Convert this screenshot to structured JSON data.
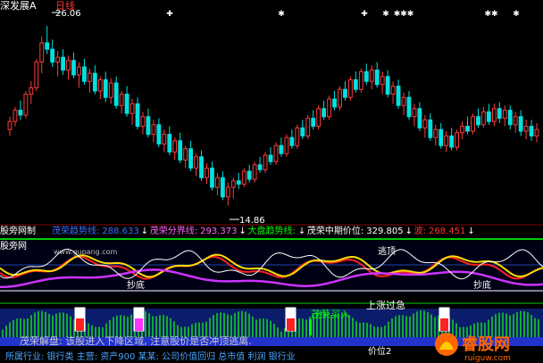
{
  "window": {
    "title": "深发展A",
    "period_label": "日线"
  },
  "price_panel": {
    "high_label": "26.06",
    "low_label": "14.86",
    "event_marks": [
      "✚",
      "✱",
      "✚",
      "✱",
      "✱✱✱",
      "✱✱",
      "✱"
    ]
  },
  "legend": {
    "prefix": "股旁网制",
    "items": [
      {
        "label": "茂荣趋势线:",
        "value": "288.633",
        "color": "#3a6bff"
      },
      {
        "label": "茂荣分界线:",
        "value": "293.373",
        "color": "#ff66ff"
      },
      {
        "label": "大盘趋势线:",
        "value": "",
        "color": "#00ff00"
      },
      {
        "label": "茂荣中期价位:",
        "value": "329.805",
        "color": "#ffffff"
      },
      {
        "label": "波:",
        "value": "268.451",
        "color": "#ff3333"
      }
    ]
  },
  "indicator_panel": {
    "site_label": "股旁网",
    "watermark": "www.gupang.com",
    "annotations": [
      "逃顶",
      "抄底",
      "抄底"
    ]
  },
  "signal_panel": {
    "annotations": [
      "上涨过急",
      "茂荣买入",
      "价位2"
    ]
  },
  "footer": {
    "line1": "茂荣解盘: 该股进入下降区域, 注意股价是否冲顶逃离.",
    "line2": "所属行业: 银行类   主营: 资产900   某某: 公司价值回归 总市值 利润 银行业"
  },
  "logo": {
    "text": "睿股网",
    "url": "ruiguw.com"
  },
  "chart_data": {
    "type": "candlestick",
    "title": "深发展A 日线",
    "xlabel": "",
    "ylabel": "",
    "ylim": [
      14,
      27
    ],
    "grid": false,
    "legend_position": "top-left",
    "annotations": [
      {
        "label": "26.06",
        "type": "high"
      },
      {
        "label": "14.86",
        "type": "low"
      }
    ],
    "candles": [
      [
        19.6,
        20.4,
        19.2,
        20.1
      ],
      [
        20.1,
        21.0,
        19.8,
        20.8
      ],
      [
        20.8,
        21.4,
        20.2,
        20.5
      ],
      [
        20.5,
        22.0,
        20.3,
        21.8
      ],
      [
        21.8,
        22.6,
        21.2,
        22.2
      ],
      [
        22.2,
        24.0,
        22.0,
        23.8
      ],
      [
        23.8,
        25.4,
        23.1,
        25.0
      ],
      [
        25.0,
        26.06,
        24.3,
        24.6
      ],
      [
        24.6,
        25.2,
        23.5,
        23.8
      ],
      [
        23.8,
        24.5,
        22.9,
        24.1
      ],
      [
        24.1,
        24.6,
        23.0,
        23.3
      ],
      [
        23.3,
        24.2,
        22.7,
        23.9
      ],
      [
        23.9,
        24.4,
        22.8,
        23.0
      ],
      [
        23.0,
        23.8,
        22.2,
        23.5
      ],
      [
        23.5,
        24.0,
        22.4,
        22.6
      ],
      [
        22.6,
        23.4,
        21.9,
        23.1
      ],
      [
        23.1,
        23.6,
        21.8,
        22.0
      ],
      [
        22.0,
        22.9,
        21.5,
        22.7
      ],
      [
        22.7,
        23.2,
        21.3,
        21.6
      ],
      [
        21.6,
        22.8,
        21.2,
        22.5
      ],
      [
        22.5,
        22.9,
        20.9,
        21.1
      ],
      [
        21.1,
        22.0,
        20.6,
        21.8
      ],
      [
        21.8,
        22.3,
        20.4,
        20.6
      ],
      [
        20.6,
        21.5,
        19.9,
        21.2
      ],
      [
        21.2,
        21.6,
        19.6,
        19.8
      ],
      [
        19.8,
        20.7,
        19.3,
        20.4
      ],
      [
        20.4,
        20.9,
        19.1,
        19.3
      ],
      [
        19.3,
        20.2,
        18.8,
        19.9
      ],
      [
        19.9,
        20.3,
        18.5,
        18.7
      ],
      [
        18.7,
        19.6,
        18.2,
        19.3
      ],
      [
        19.3,
        19.8,
        18.0,
        18.2
      ],
      [
        18.2,
        19.1,
        17.7,
        18.9
      ],
      [
        18.9,
        19.4,
        17.5,
        17.7
      ],
      [
        17.7,
        18.6,
        17.2,
        18.4
      ],
      [
        18.4,
        18.9,
        17.0,
        17.2
      ],
      [
        17.2,
        18.1,
        16.7,
        17.9
      ],
      [
        17.9,
        18.3,
        16.4,
        16.6
      ],
      [
        16.6,
        17.5,
        16.2,
        17.2
      ],
      [
        17.2,
        17.6,
        15.8,
        16.0
      ],
      [
        16.0,
        16.9,
        15.5,
        16.6
      ],
      [
        16.6,
        17.0,
        15.2,
        15.4
      ],
      [
        15.4,
        16.3,
        14.86,
        16.0
      ],
      [
        16.0,
        16.6,
        15.3,
        16.4
      ],
      [
        16.4,
        16.9,
        15.9,
        16.2
      ],
      [
        16.2,
        17.2,
        16.0,
        17.0
      ],
      [
        17.0,
        17.4,
        16.3,
        16.5
      ],
      [
        16.5,
        17.6,
        16.3,
        17.4
      ],
      [
        17.4,
        17.9,
        16.9,
        17.1
      ],
      [
        17.1,
        18.2,
        16.9,
        18.0
      ],
      [
        18.0,
        18.5,
        17.4,
        17.6
      ],
      [
        17.6,
        18.8,
        17.4,
        18.6
      ],
      [
        18.6,
        19.1,
        17.9,
        18.1
      ],
      [
        18.1,
        19.3,
        17.9,
        19.1
      ],
      [
        19.1,
        19.6,
        18.4,
        18.6
      ],
      [
        18.6,
        19.9,
        18.4,
        19.7
      ],
      [
        19.7,
        20.2,
        19.0,
        19.2
      ],
      [
        19.2,
        20.5,
        19.0,
        20.3
      ],
      [
        20.3,
        20.8,
        19.6,
        19.8
      ],
      [
        19.8,
        21.1,
        19.6,
        20.9
      ],
      [
        20.9,
        21.4,
        20.2,
        20.4
      ],
      [
        20.4,
        21.7,
        20.2,
        21.5
      ],
      [
        21.5,
        22.0,
        20.8,
        21.0
      ],
      [
        21.0,
        22.3,
        20.8,
        22.1
      ],
      [
        22.1,
        22.6,
        21.4,
        21.6
      ],
      [
        21.6,
        22.9,
        21.4,
        22.7
      ],
      [
        22.7,
        23.2,
        21.9,
        22.1
      ],
      [
        22.1,
        23.4,
        21.9,
        23.2
      ],
      [
        23.2,
        23.7,
        22.4,
        22.6
      ],
      [
        22.6,
        23.6,
        22.1,
        23.3
      ],
      [
        23.3,
        23.8,
        22.2,
        22.4
      ],
      [
        22.4,
        23.2,
        21.8,
        22.9
      ],
      [
        22.9,
        23.3,
        21.6,
        21.8
      ],
      [
        21.8,
        22.6,
        21.2,
        22.3
      ],
      [
        22.3,
        22.7,
        20.9,
        21.1
      ],
      [
        21.1,
        21.9,
        20.5,
        21.6
      ],
      [
        21.6,
        22.0,
        20.2,
        20.4
      ],
      [
        20.4,
        21.2,
        19.8,
        20.9
      ],
      [
        20.9,
        21.3,
        19.5,
        19.7
      ],
      [
        19.7,
        20.5,
        19.1,
        20.2
      ],
      [
        20.2,
        20.6,
        18.9,
        19.1
      ],
      [
        19.1,
        19.9,
        18.6,
        19.6
      ],
      [
        19.6,
        20.0,
        18.4,
        18.6
      ],
      [
        18.6,
        19.5,
        18.2,
        19.2
      ],
      [
        19.2,
        19.7,
        18.3,
        18.5
      ],
      [
        18.5,
        19.6,
        18.3,
        19.4
      ],
      [
        19.4,
        20.1,
        19.0,
        19.8
      ],
      [
        19.8,
        20.4,
        19.3,
        19.5
      ],
      [
        19.5,
        20.6,
        19.3,
        20.4
      ],
      [
        20.4,
        20.9,
        19.7,
        19.9
      ],
      [
        19.9,
        21.0,
        19.7,
        20.7
      ],
      [
        20.7,
        21.2,
        19.9,
        20.1
      ],
      [
        20.1,
        21.2,
        19.8,
        20.9
      ],
      [
        20.9,
        21.3,
        20.0,
        20.3
      ],
      [
        20.3,
        21.1,
        19.8,
        20.8
      ],
      [
        20.8,
        21.1,
        19.6,
        19.9
      ],
      [
        19.9,
        20.7,
        19.4,
        20.4
      ],
      [
        20.4,
        20.8,
        19.2,
        19.5
      ],
      [
        19.5,
        20.2,
        19.0,
        19.8
      ],
      [
        19.8,
        20.2,
        18.9,
        19.2
      ],
      [
        19.2,
        20.0,
        18.8,
        19.6
      ]
    ]
  }
}
